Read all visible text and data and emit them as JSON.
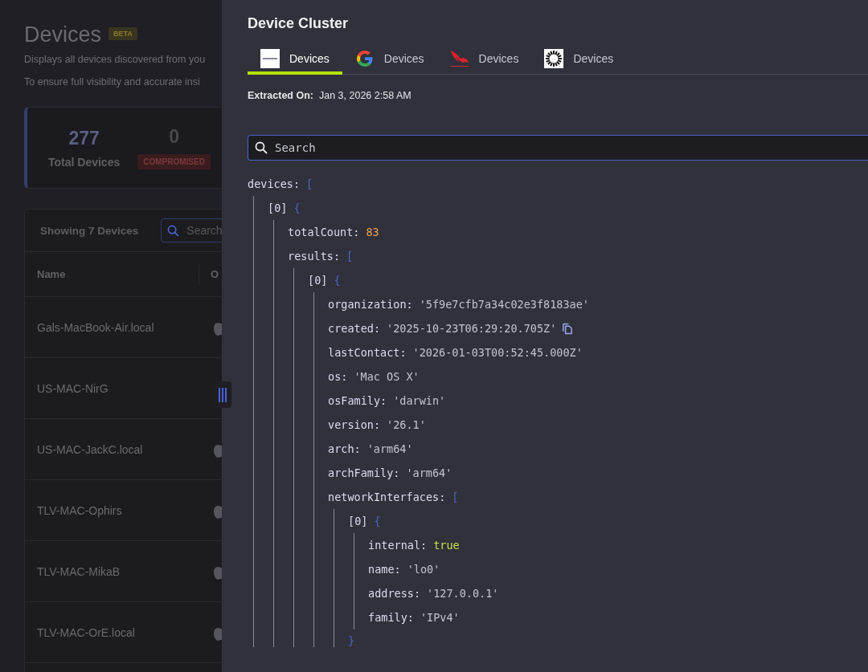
{
  "page": {
    "title": "Devices",
    "badge": "BETA",
    "description": "Displays all devices discovered from you",
    "note": "To ensure full visibility and accurate insi",
    "stats": [
      {
        "value": "277",
        "label": "Total Devices",
        "kind": "plain"
      },
      {
        "value": "0",
        "label": "COMPROMISED",
        "kind": "alert"
      }
    ],
    "table": {
      "count_label": "Showing 7 Devices",
      "search_placeholder": "Search",
      "columns": [
        "Name",
        "O"
      ],
      "rows": [
        {
          "name": "Gals-MacBook-Air.local",
          "os_icon": true
        },
        {
          "name": "US-MAC-NirG",
          "os_icon": false
        },
        {
          "name": "US-MAC-JackC.local",
          "os_icon": true
        },
        {
          "name": "TLV-MAC-Ophirs",
          "os_icon": true
        },
        {
          "name": "TLV-MAC-MikaB",
          "os_icon": true
        },
        {
          "name": "TLV-MAC-OrE.local",
          "os_icon": true
        }
      ]
    }
  },
  "drawer": {
    "title": "Device Cluster",
    "tabs": [
      {
        "label": "Devices",
        "kind": "square",
        "selected": true
      },
      {
        "label": "Devices",
        "kind": "g",
        "selected": false
      },
      {
        "label": "Devices",
        "kind": "bird",
        "selected": false
      },
      {
        "label": "Devices",
        "kind": "sun",
        "selected": false
      }
    ],
    "extracted_label": "Extracted On:",
    "extracted_value": "Jan 3, 2026 2:58 AM",
    "search_placeholder": "Search",
    "tree": {
      "key": "devices:",
      "open": "[",
      "kind": "node",
      "children": [
        {
          "key": "[0]",
          "open": "{",
          "kind": "node",
          "children": [
            {
              "key": "totalCount:",
              "value": "83",
              "kind": "number"
            },
            {
              "key": "results:",
              "open": "[",
              "kind": "node",
              "children": [
                {
                  "key": "[0]",
                  "open": "{",
                  "kind": "node",
                  "children": [
                    {
                      "key": "organization:",
                      "value": "'5f9e7cfb7a34c02e3f8183ae'",
                      "kind": "string"
                    },
                    {
                      "key": "created:",
                      "value": "'2025-10-23T06:29:20.705Z'",
                      "kind": "string",
                      "copy": true
                    },
                    {
                      "key": "lastContact:",
                      "value": "'2026-01-03T00:52:45.000Z'",
                      "kind": "string"
                    },
                    {
                      "key": "os:",
                      "value": "'Mac OS X'",
                      "kind": "string"
                    },
                    {
                      "key": "osFamily:",
                      "value": "'darwin'",
                      "kind": "string"
                    },
                    {
                      "key": "version:",
                      "value": "'26.1'",
                      "kind": "string"
                    },
                    {
                      "key": "arch:",
                      "value": "'arm64'",
                      "kind": "string"
                    },
                    {
                      "key": "archFamily:",
                      "value": "'arm64'",
                      "kind": "string"
                    },
                    {
                      "key": "networkInterfaces:",
                      "open": "[",
                      "kind": "node",
                      "children": [
                        {
                          "key": "[0]",
                          "open": "{",
                          "kind": "node",
                          "close": "}",
                          "children": [
                            {
                              "key": "internal:",
                              "value": "true",
                              "kind": "boolean"
                            },
                            {
                              "key": "name:",
                              "value": "'lo0'",
                              "kind": "string"
                            },
                            {
                              "key": "address:",
                              "value": "'127.0.0.1'",
                              "kind": "string"
                            },
                            {
                              "key": "family:",
                              "value": "'IPv4'",
                              "kind": "string"
                            }
                          ]
                        }
                      ]
                    }
                  ]
                }
              ]
            }
          ]
        }
      ]
    }
  }
}
